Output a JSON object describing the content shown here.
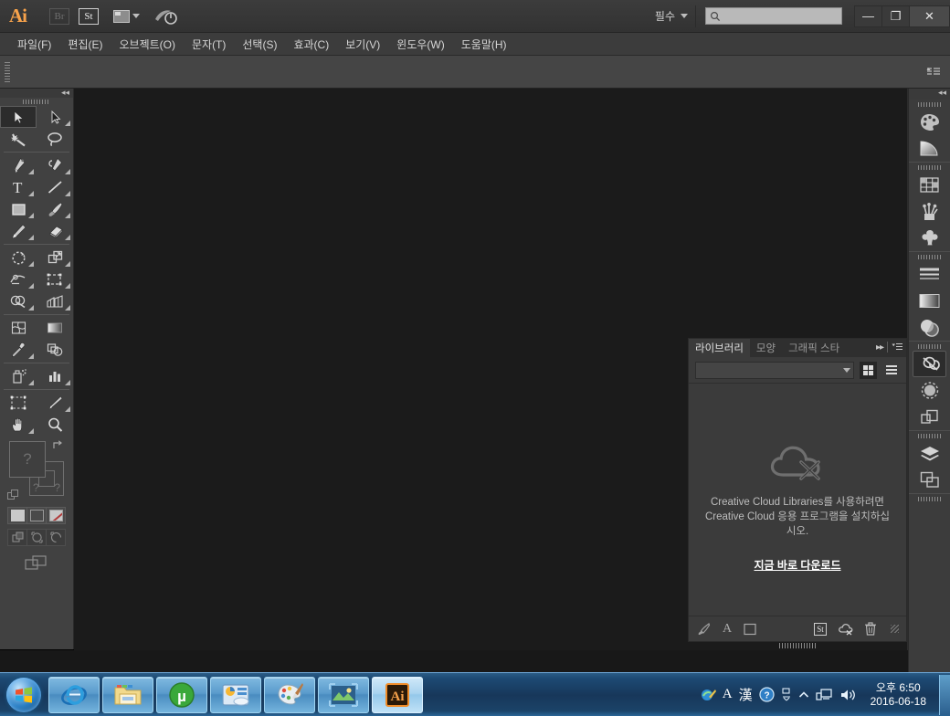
{
  "titlebar": {
    "app_logo": "Ai",
    "bridge_button": "Br",
    "stock_button": "St",
    "arrange_icon": "arrange-documents-icon",
    "home_icon": "go-to-start-icon",
    "workspace_label": "필수",
    "search_placeholder": "",
    "search_value": "",
    "search_icon": "search-icon",
    "minimize_label": "—",
    "restore_label": "❐",
    "close_label": "✕"
  },
  "menubar": {
    "items": [
      {
        "label": "파일(F)"
      },
      {
        "label": "편집(E)"
      },
      {
        "label": "오브젝트(O)"
      },
      {
        "label": "문자(T)"
      },
      {
        "label": "선택(S)"
      },
      {
        "label": "효과(C)"
      },
      {
        "label": "보기(V)"
      },
      {
        "label": "윈도우(W)"
      },
      {
        "label": "도움말(H)"
      }
    ]
  },
  "controlbar": {
    "menu_icon": "panel-menu-icon",
    "grip": "drag-grip"
  },
  "toolpanel": {
    "collapse_label": "◂◂",
    "tools": [
      {
        "name": "selection-tool",
        "selected": true,
        "has_flyout": false
      },
      {
        "name": "direct-selection-tool",
        "selected": false,
        "has_flyout": true
      },
      {
        "name": "magic-wand-tool",
        "selected": false,
        "has_flyout": false
      },
      {
        "name": "lasso-tool",
        "selected": false,
        "has_flyout": false
      },
      {
        "name": "pen-tool",
        "selected": false,
        "has_flyout": true
      },
      {
        "name": "add-anchor-point-tool",
        "selected": false,
        "has_flyout": true
      },
      {
        "name": "type-tool",
        "selected": false,
        "has_flyout": true
      },
      {
        "name": "line-segment-tool",
        "selected": false,
        "has_flyout": true
      },
      {
        "name": "rectangle-tool",
        "selected": false,
        "has_flyout": true
      },
      {
        "name": "paintbrush-tool",
        "selected": false,
        "has_flyout": true
      },
      {
        "name": "pencil-tool",
        "selected": false,
        "has_flyout": true
      },
      {
        "name": "eraser-tool",
        "selected": false,
        "has_flyout": true
      },
      {
        "name": "rotate-tool",
        "selected": false,
        "has_flyout": true
      },
      {
        "name": "scale-tool",
        "selected": false,
        "has_flyout": true
      },
      {
        "name": "width-tool",
        "selected": false,
        "has_flyout": true
      },
      {
        "name": "free-transform-tool",
        "selected": false,
        "has_flyout": true
      },
      {
        "name": "shape-builder-tool",
        "selected": false,
        "has_flyout": true
      },
      {
        "name": "perspective-grid-tool",
        "selected": false,
        "has_flyout": true
      },
      {
        "name": "mesh-tool",
        "selected": false,
        "has_flyout": false
      },
      {
        "name": "gradient-tool",
        "selected": false,
        "has_flyout": false
      },
      {
        "name": "eyedropper-tool",
        "selected": false,
        "has_flyout": true
      },
      {
        "name": "blend-tool",
        "selected": false,
        "has_flyout": false
      },
      {
        "name": "symbol-sprayer-tool",
        "selected": false,
        "has_flyout": true
      },
      {
        "name": "column-graph-tool",
        "selected": false,
        "has_flyout": true
      },
      {
        "name": "artboard-tool",
        "selected": false,
        "has_flyout": false
      },
      {
        "name": "slice-tool",
        "selected": false,
        "has_flyout": true
      },
      {
        "name": "hand-tool",
        "selected": false,
        "has_flyout": true
      },
      {
        "name": "zoom-tool",
        "selected": false,
        "has_flyout": false
      }
    ],
    "fill_value": "?",
    "stroke_value": "?",
    "swap_icon": "swap-fill-stroke-icon",
    "default_icon": "default-fill-stroke-icon",
    "color_modes": [
      {
        "name": "color-mode-button",
        "label": ""
      },
      {
        "name": "gradient-mode-button",
        "label": ""
      },
      {
        "name": "none-mode-button",
        "label": ""
      }
    ],
    "draw_modes": [
      {
        "name": "draw-normal-button"
      },
      {
        "name": "draw-behind-button"
      },
      {
        "name": "draw-inside-button"
      }
    ],
    "screen_mode": "change-screen-mode-button"
  },
  "library_panel": {
    "tabs": [
      {
        "label": "라이브러리",
        "active": true
      },
      {
        "label": "모양",
        "active": false
      },
      {
        "label": "그래픽 스타",
        "active": false
      }
    ],
    "collapse_icon": "collapse-panel-icon",
    "menu_icon": "panel-menu-icon",
    "combo_value": "",
    "grid_view_icon": "grid-view-icon",
    "list_view_icon": "list-view-icon",
    "empty_icon": "cloud-disconnected-icon",
    "message": "Creative Cloud Libraries를 사용하려면 Creative Cloud 응용 프로그램을 설치하십시오.",
    "download_link": "지금 바로 다운로드",
    "footer": {
      "left": [
        {
          "name": "add-graphic-icon"
        },
        {
          "name": "add-text-style-icon",
          "label": "A"
        },
        {
          "name": "add-shape-icon"
        }
      ],
      "right": [
        {
          "name": "adobe-stock-icon",
          "label": "St"
        },
        {
          "name": "sync-off-icon"
        },
        {
          "name": "delete-icon"
        }
      ]
    }
  },
  "rightdock": {
    "collapse_label": "◂◂",
    "items": [
      {
        "name": "color-panel-icon",
        "selected": false
      },
      {
        "name": "color-guide-panel-icon",
        "selected": false
      },
      {
        "name": "swatches-panel-icon",
        "selected": false
      },
      {
        "name": "brushes-panel-icon",
        "selected": false
      },
      {
        "name": "symbols-panel-icon",
        "selected": false
      },
      {
        "name": "stroke-panel-icon",
        "selected": false
      },
      {
        "name": "gradient-panel-icon",
        "selected": false
      },
      {
        "name": "transparency-panel-icon",
        "selected": false
      },
      {
        "name": "libraries-panel-icon",
        "selected": true
      },
      {
        "name": "appearance-panel-icon",
        "selected": false
      },
      {
        "name": "graphic-styles-panel-icon",
        "selected": false
      },
      {
        "name": "layers-panel-icon",
        "selected": false
      },
      {
        "name": "artboards-panel-icon",
        "selected": false
      }
    ]
  },
  "taskbar": {
    "start_button": "start-orb",
    "items": [
      {
        "name": "taskbar-internet-explorer",
        "active": false
      },
      {
        "name": "taskbar-windows-explorer",
        "active": false
      },
      {
        "name": "taskbar-utorrent",
        "active": false,
        "label": "µ"
      },
      {
        "name": "taskbar-control-app",
        "active": false
      },
      {
        "name": "taskbar-paint",
        "active": false
      },
      {
        "name": "taskbar-photo-viewer",
        "active": false
      },
      {
        "name": "taskbar-illustrator",
        "active": true,
        "label": "Ai"
      }
    ],
    "tray": [
      {
        "name": "ime-pen-icon",
        "label": ""
      },
      {
        "name": "ime-alphabet-icon",
        "label": "A"
      },
      {
        "name": "ime-hanja-icon",
        "label": "漢"
      },
      {
        "name": "ime-help-icon",
        "label": "?"
      },
      {
        "name": "ime-options-icon",
        "label": ""
      },
      {
        "name": "show-hidden-icons-icon",
        "label": "▲"
      },
      {
        "name": "network-icon",
        "label": ""
      },
      {
        "name": "volume-icon",
        "label": ""
      }
    ],
    "clock_time": "오후 6:50",
    "clock_date": "2016-06-18",
    "show_desktop": "show-desktop-button"
  },
  "colors": {
    "chrome": "#3c3c3c",
    "panel": "#3b3b3b",
    "canvas": "#1b1b1b",
    "accent_orange": "#f7a24b",
    "taskbar_blue": "#17375a"
  }
}
